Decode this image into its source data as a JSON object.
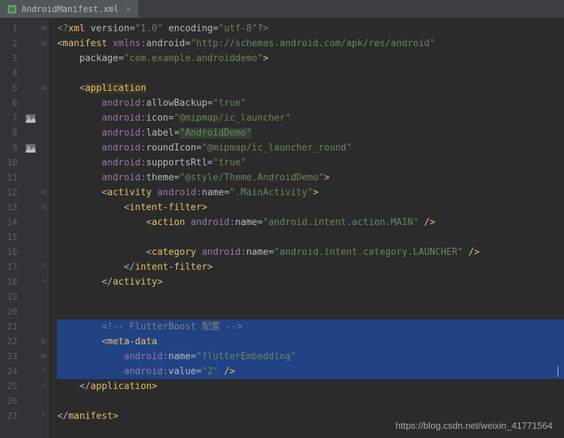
{
  "tab": {
    "name": "AndroidManifest.xml"
  },
  "lines": [
    {
      "n": 1,
      "fold": "-",
      "segs": [
        [
          "pi",
          "<?"
        ],
        [
          "tag",
          "xml "
        ],
        [
          "attr",
          "version"
        ],
        [
          "eq",
          "="
        ],
        [
          "str",
          "\"1.0\""
        ],
        [
          "attr",
          " encoding"
        ],
        [
          "eq",
          "="
        ],
        [
          "str",
          "\"utf-8\""
        ],
        [
          "pi",
          "?>"
        ]
      ]
    },
    {
      "n": 2,
      "fold": "-",
      "segs": [
        [
          "eq",
          "<"
        ],
        [
          "tag",
          "manifest "
        ],
        [
          "ns",
          "xmlns:"
        ],
        [
          "attr",
          "android"
        ],
        [
          "eq",
          "="
        ],
        [
          "str",
          "\"http://schemas.android.com/apk/res/android\""
        ]
      ]
    },
    {
      "n": 3,
      "segs": [
        [
          "eq",
          "    "
        ],
        [
          "attr",
          "package"
        ],
        [
          "eq",
          "="
        ],
        [
          "str",
          "\"com.example.androiddemo\""
        ],
        [
          "tag",
          ">"
        ]
      ]
    },
    {
      "n": 4,
      "segs": []
    },
    {
      "n": 5,
      "fold": "-",
      "segs": [
        [
          "eq",
          "    <"
        ],
        [
          "tag hl1",
          "application"
        ]
      ]
    },
    {
      "n": 6,
      "segs": [
        [
          "eq",
          "        "
        ],
        [
          "ns",
          "android:"
        ],
        [
          "attr",
          "allowBackup"
        ],
        [
          "eq",
          "="
        ],
        [
          "str",
          "\"true\""
        ]
      ]
    },
    {
      "n": 7,
      "icon": "img",
      "segs": [
        [
          "eq",
          "        "
        ],
        [
          "ns",
          "android:"
        ],
        [
          "attr",
          "icon"
        ],
        [
          "eq",
          "="
        ],
        [
          "str",
          "\"@mipmap/ic_launcher\""
        ]
      ]
    },
    {
      "n": 8,
      "segs": [
        [
          "eq",
          "        "
        ],
        [
          "ns",
          "android:"
        ],
        [
          "attr",
          "label"
        ],
        [
          "eq",
          "="
        ],
        [
          "str hl2",
          "\"AndroidDemo\""
        ]
      ]
    },
    {
      "n": 9,
      "icon": "img",
      "segs": [
        [
          "eq",
          "        "
        ],
        [
          "ns",
          "android:"
        ],
        [
          "attr",
          "roundIcon"
        ],
        [
          "eq",
          "="
        ],
        [
          "str",
          "\"@mipmap/ic_launcher_round\""
        ]
      ]
    },
    {
      "n": 10,
      "segs": [
        [
          "eq",
          "        "
        ],
        [
          "ns",
          "android:"
        ],
        [
          "attr",
          "supportsRtl"
        ],
        [
          "eq",
          "="
        ],
        [
          "str",
          "\"true\""
        ]
      ]
    },
    {
      "n": 11,
      "segs": [
        [
          "eq",
          "        "
        ],
        [
          "ns",
          "android:"
        ],
        [
          "attr",
          "theme"
        ],
        [
          "eq",
          "="
        ],
        [
          "str",
          "\"@style/Theme.AndroidDemo\""
        ],
        [
          "tag",
          ">"
        ]
      ]
    },
    {
      "n": 12,
      "fold": "-",
      "segs": [
        [
          "eq",
          "        <"
        ],
        [
          "tag",
          "activity "
        ],
        [
          "ns",
          "android:"
        ],
        [
          "attr",
          "name"
        ],
        [
          "eq",
          "="
        ],
        [
          "str",
          "\".MainActivity\""
        ],
        [
          "tag",
          ">"
        ]
      ]
    },
    {
      "n": 13,
      "fold": "-",
      "segs": [
        [
          "eq",
          "            <"
        ],
        [
          "tag",
          "intent-filter"
        ],
        [
          "tag",
          ">"
        ]
      ]
    },
    {
      "n": 14,
      "segs": [
        [
          "eq",
          "                <"
        ],
        [
          "tag",
          "action "
        ],
        [
          "ns",
          "android:"
        ],
        [
          "attr",
          "name"
        ],
        [
          "eq",
          "="
        ],
        [
          "str",
          "\"android.intent.action.MAIN\""
        ],
        [
          "tag",
          " />"
        ]
      ]
    },
    {
      "n": 15,
      "segs": []
    },
    {
      "n": 16,
      "segs": [
        [
          "eq",
          "                <"
        ],
        [
          "tag",
          "category "
        ],
        [
          "ns",
          "android:"
        ],
        [
          "attr",
          "name"
        ],
        [
          "eq",
          "="
        ],
        [
          "str",
          "\"android.intent.category.LAUNCHER\""
        ],
        [
          "tag",
          " />"
        ]
      ]
    },
    {
      "n": 17,
      "fold": "_",
      "segs": [
        [
          "eq",
          "            </"
        ],
        [
          "tag",
          "intent-filter"
        ],
        [
          "tag",
          ">"
        ]
      ]
    },
    {
      "n": 18,
      "fold": "_",
      "segs": [
        [
          "eq",
          "        </"
        ],
        [
          "tag",
          "activity"
        ],
        [
          "tag",
          ">"
        ]
      ]
    },
    {
      "n": 19,
      "segs": []
    },
    {
      "n": 20,
      "segs": []
    },
    {
      "n": 21,
      "sel": true,
      "segs": [
        [
          "eq",
          "        "
        ],
        [
          "cmt",
          "<!-- FlutterBoost 配置 -->"
        ]
      ]
    },
    {
      "n": 22,
      "sel": true,
      "fold": "-",
      "segs": [
        [
          "eq",
          "        <"
        ],
        [
          "tag",
          "meta-data"
        ]
      ]
    },
    {
      "n": 23,
      "sel": true,
      "fold": "-",
      "segs": [
        [
          "eq",
          "            "
        ],
        [
          "ns",
          "android:"
        ],
        [
          "attr",
          "name"
        ],
        [
          "eq",
          "="
        ],
        [
          "str",
          "\"flutterEmbedding\""
        ]
      ]
    },
    {
      "n": 24,
      "sel": true,
      "cur": true,
      "fold": "_",
      "segs": [
        [
          "eq",
          "            "
        ],
        [
          "ns",
          "android:"
        ],
        [
          "attr",
          "value"
        ],
        [
          "eq",
          "="
        ],
        [
          "str",
          "\"2\""
        ],
        [
          "tag",
          " />"
        ]
      ]
    },
    {
      "n": 25,
      "fold": "_",
      "segs": [
        [
          "eq",
          "    </"
        ],
        [
          "tag",
          "application"
        ],
        [
          "tag",
          ">"
        ]
      ]
    },
    {
      "n": 26,
      "segs": []
    },
    {
      "n": 27,
      "fold": "_",
      "segs": [
        [
          "eq",
          "</"
        ],
        [
          "tag",
          "manifest"
        ],
        [
          "tag",
          ">"
        ]
      ]
    }
  ],
  "watermark": "https://blog.csdn.net/weixin_41771564"
}
